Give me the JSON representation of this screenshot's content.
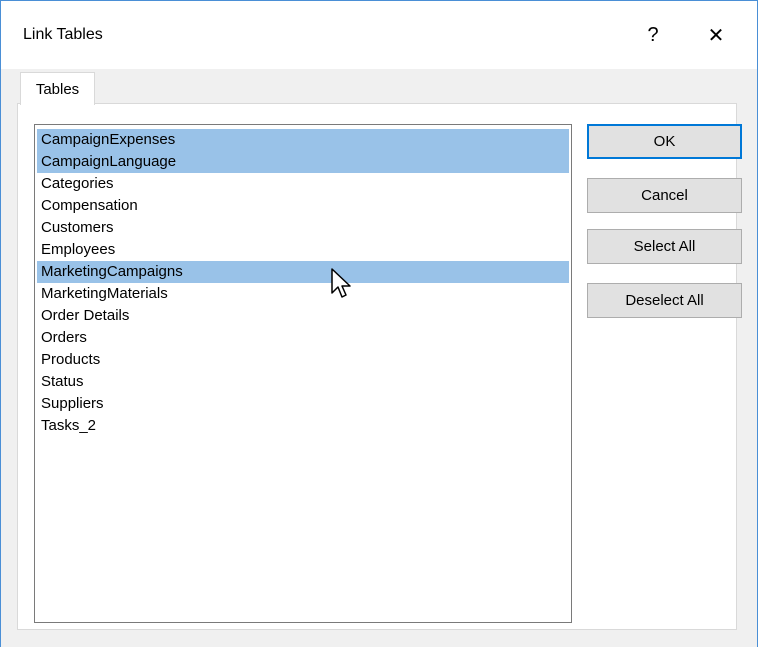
{
  "window": {
    "title": "Link Tables",
    "help_label": "?",
    "close_label": "✕"
  },
  "tabs": [
    {
      "label": "Tables",
      "active": true
    }
  ],
  "tables": [
    {
      "label": "CampaignExpenses",
      "selected": true
    },
    {
      "label": "CampaignLanguage",
      "selected": true
    },
    {
      "label": "Categories",
      "selected": false
    },
    {
      "label": "Compensation",
      "selected": false
    },
    {
      "label": "Customers",
      "selected": false
    },
    {
      "label": "Employees",
      "selected": false
    },
    {
      "label": "MarketingCampaigns",
      "selected": true
    },
    {
      "label": "MarketingMaterials",
      "selected": false
    },
    {
      "label": "Order Details",
      "selected": false
    },
    {
      "label": "Orders",
      "selected": false
    },
    {
      "label": "Products",
      "selected": false
    },
    {
      "label": "Status",
      "selected": false
    },
    {
      "label": "Suppliers",
      "selected": false
    },
    {
      "label": "Tasks_2",
      "selected": false
    }
  ],
  "buttons": {
    "ok": "OK",
    "cancel": "Cancel",
    "select_all": "Select All",
    "deselect_all": "Deselect All"
  },
  "colors": {
    "selection": "#99c2e8",
    "accent": "#0078d7"
  }
}
